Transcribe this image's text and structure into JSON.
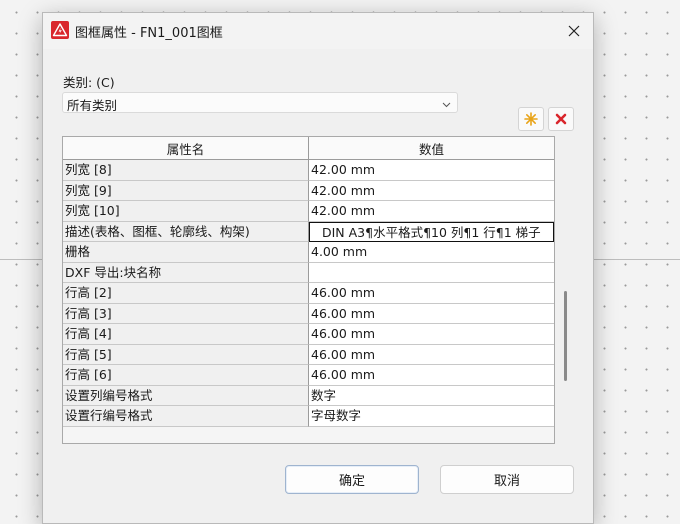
{
  "window": {
    "title": "图框属性 - FN1_001图框"
  },
  "category": {
    "label": "类别: (C)",
    "selected": "所有类别"
  },
  "grid": {
    "headers": {
      "name": "属性名",
      "value": "数值"
    },
    "rows": [
      {
        "name": "列宽 [8]",
        "value": "42.00 mm"
      },
      {
        "name": "列宽 [9]",
        "value": "42.00 mm"
      },
      {
        "name": "列宽 [10]",
        "value": "42.00 mm"
      },
      {
        "name": "描述(表格、图框、轮廓线、构架)",
        "value": "DIN A3¶水平格式¶10 列¶1 行¶1 梯子"
      },
      {
        "name": "栅格",
        "value": "4.00 mm"
      },
      {
        "name": "DXF 导出:块名称",
        "value": ""
      },
      {
        "name": "行高 [2]",
        "value": "46.00 mm"
      },
      {
        "name": "行高 [3]",
        "value": "46.00 mm"
      },
      {
        "name": "行高 [4]",
        "value": "46.00 mm"
      },
      {
        "name": "行高 [5]",
        "value": "46.00 mm"
      },
      {
        "name": "行高 [6]",
        "value": "46.00 mm"
      },
      {
        "name": "设置列编号格式",
        "value": "数字"
      },
      {
        "name": "设置行编号格式",
        "value": "字母数字"
      }
    ]
  },
  "buttons": {
    "ok": "确定",
    "cancel": "取消"
  },
  "icons": {
    "app": "warning-triangle-icon",
    "new": "sparkle-icon",
    "delete": "red-x-icon",
    "close": "close-icon",
    "dropdown": "chevron-down-icon"
  },
  "colors": {
    "app_icon": "#d9262c",
    "new_icon": "#e8a317",
    "delete_icon": "#d9262c"
  }
}
